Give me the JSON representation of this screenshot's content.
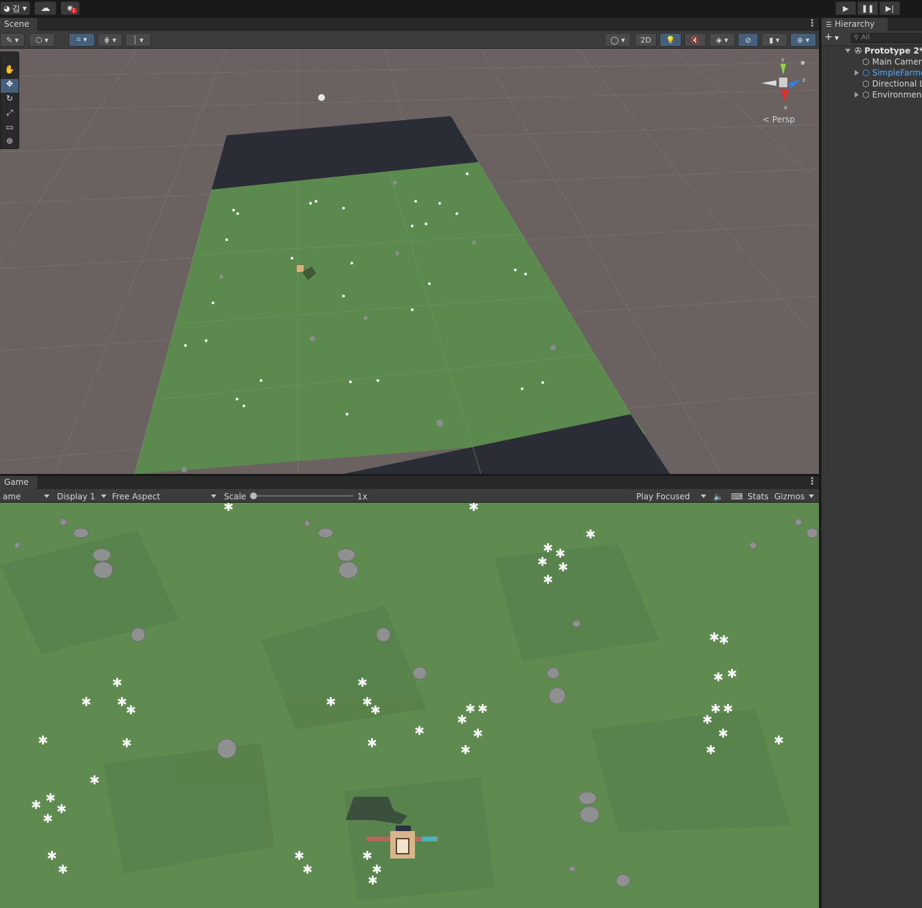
{
  "topbar": {
    "account_label": "김",
    "cloud_icon": "cloud-icon",
    "collab_badge": "1"
  },
  "scene_panel": {
    "tab_label": "Scene",
    "btn_2d": "2D",
    "persp_label": "Persp",
    "gizmo_axes": {
      "y": "y",
      "z": "z",
      "x": "x"
    }
  },
  "game_panel": {
    "tab_label": "Game",
    "mode_dropdown": "ame",
    "display_dropdown": "Display 1",
    "aspect_dropdown": "Free Aspect",
    "scale_label": "Scale",
    "scale_value": "1x",
    "scale_level": 0,
    "play_mode_dropdown": "Play Focused",
    "stats_label": "Stats",
    "gizmos_label": "Gizmos"
  },
  "hierarchy": {
    "tab_label": "Hierarchy",
    "search_placeholder": "All",
    "scene_name": "Prototype 2*",
    "items": [
      {
        "label": "Main Camera",
        "prefab": false,
        "expandable": false
      },
      {
        "label": "SimpleFarmer",
        "prefab": true,
        "expandable": true
      },
      {
        "label": "Directional Light",
        "prefab": false,
        "expandable": false
      },
      {
        "label": "Environment",
        "prefab": false,
        "expandable": true
      }
    ]
  },
  "colors": {
    "editor_bg": "#383838",
    "grass": "#5f8a50",
    "ground_plane": "#6a6260",
    "dark_tile": "#2a2d35",
    "accent_blue": "#46607c",
    "prefab_blue": "#5aa7ff"
  }
}
